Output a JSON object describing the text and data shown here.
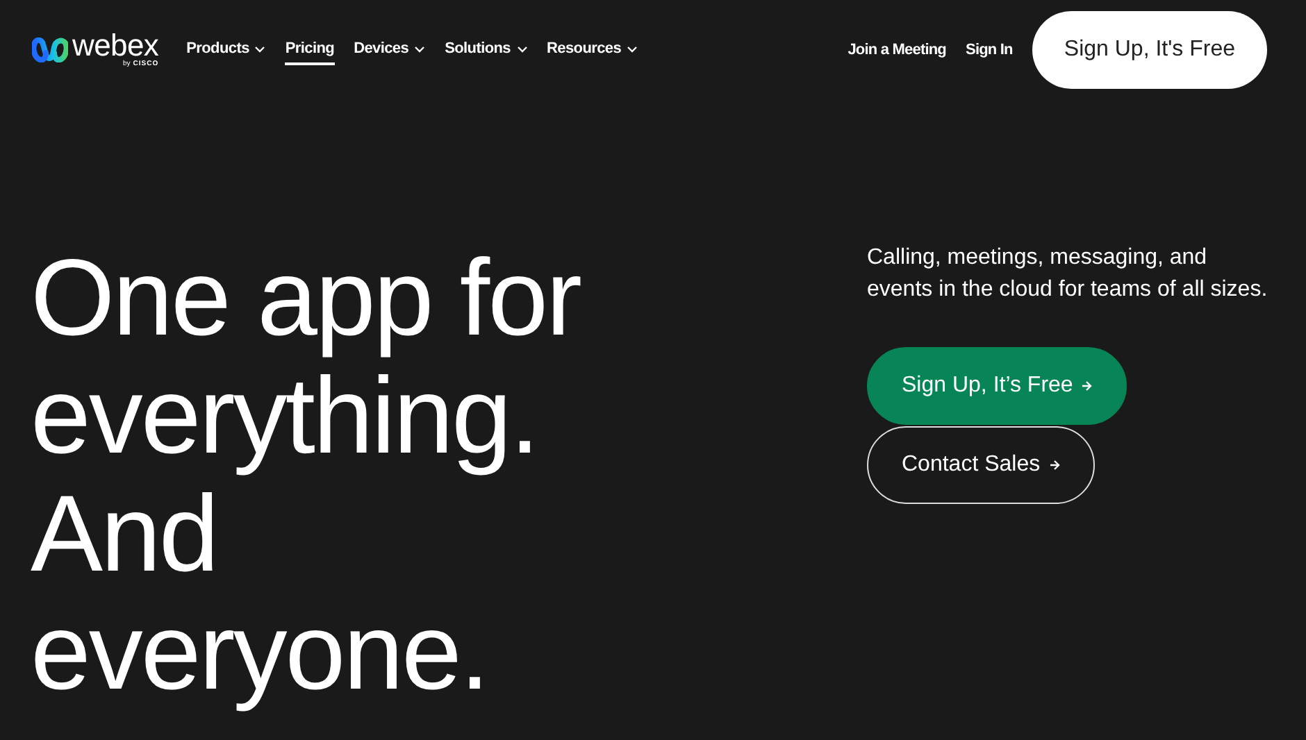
{
  "logo": {
    "wordmark": "webex",
    "byline": "by",
    "brand": "CISCO"
  },
  "nav": [
    {
      "label": "Products",
      "has_menu": true,
      "selected": false
    },
    {
      "label": "Pricing",
      "has_menu": false,
      "selected": true
    },
    {
      "label": "Devices",
      "has_menu": true,
      "selected": false
    },
    {
      "label": "Solutions",
      "has_menu": true,
      "selected": false
    },
    {
      "label": "Resources",
      "has_menu": true,
      "selected": false
    }
  ],
  "header_links": [
    "Join a Meeting",
    "Sign In"
  ],
  "header_button": "Sign Up, It's Free",
  "headline": "One app for everything. And everyone.",
  "description": "Calling, meetings, messaging, and events in the cloud for teams of all sizes.",
  "actions": [
    {
      "label": "Sign Up, It’s Free",
      "kind": "primary"
    },
    {
      "label": "Contact Sales",
      "kind": "outline"
    }
  ]
}
